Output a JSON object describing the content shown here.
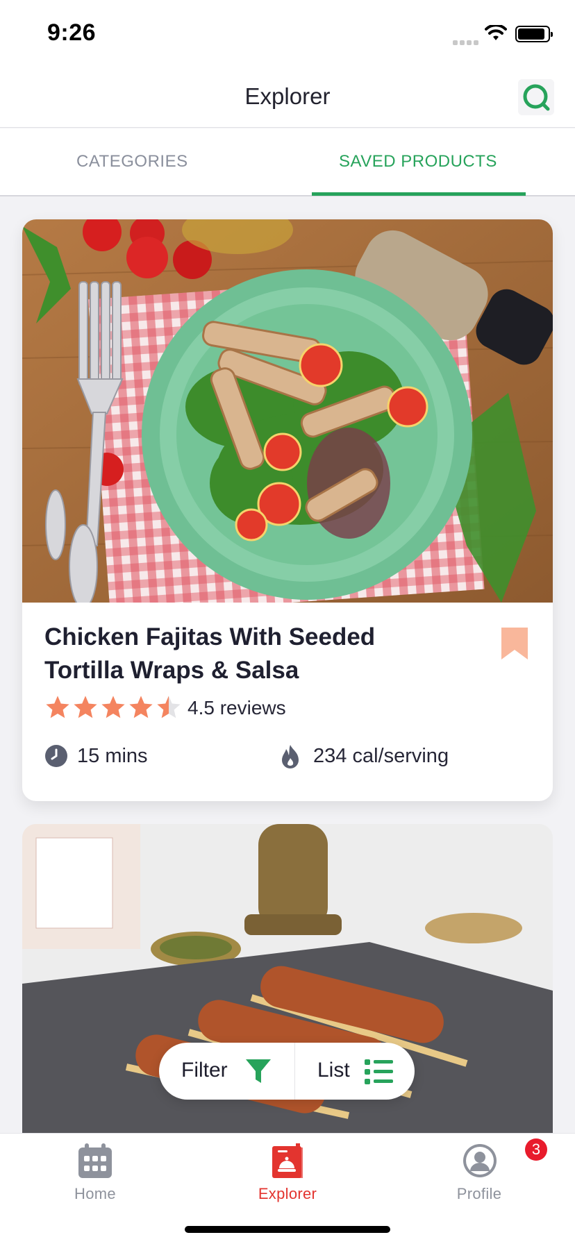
{
  "status_bar": {
    "time": "9:26"
  },
  "header": {
    "title": "Explorer",
    "search_icon": "search-icon"
  },
  "tabs": [
    {
      "label": "CATEGORIES",
      "active": false
    },
    {
      "label": "SAVED PRODUCTS",
      "active": true
    }
  ],
  "colors": {
    "accent_green": "#27a35b",
    "accent_red": "#e3342f",
    "star": "#f4845f",
    "bookmark": "#f9b79b"
  },
  "cards": [
    {
      "title": "Chicken Fajitas With Seeded Tortilla Wraps & Salsa",
      "rating": 4.5,
      "rating_number": "4.5",
      "rating_suffix": "reviews",
      "time_value": "15",
      "time_unit": "mins",
      "calories_value": "234",
      "calories_unit": "cal/serving",
      "saved": true
    },
    {
      "title": "",
      "image": "kebab-skewers"
    }
  ],
  "floating_actions": {
    "filter_label": "Filter",
    "list_label": "List"
  },
  "bottom_nav": {
    "items": [
      {
        "label": "Home",
        "icon": "calendar-grid-icon",
        "active": false
      },
      {
        "label": "Explorer",
        "icon": "recipe-book-icon",
        "active": true
      },
      {
        "label": "Profile",
        "icon": "user-avatar-icon",
        "active": false
      }
    ],
    "profile_badge": "3"
  }
}
